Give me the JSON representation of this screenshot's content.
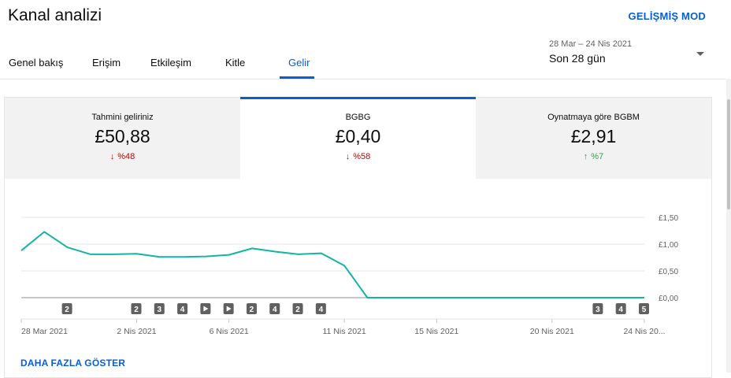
{
  "header": {
    "title": "Kanal analizi",
    "advanced_mode": "GELİŞMİŞ MOD"
  },
  "tabs": [
    {
      "label": "Genel bakış"
    },
    {
      "label": "Erişim"
    },
    {
      "label": "Etkileşim"
    },
    {
      "label": "Kitle"
    },
    {
      "label": "Gelir",
      "active": true
    }
  ],
  "date_range": {
    "range": "28 Mar – 24 Nis 2021",
    "label": "Son 28 gün"
  },
  "metrics": [
    {
      "label": "Tahmini geliriniz",
      "value": "£50,88",
      "change": "%48",
      "direction": "down"
    },
    {
      "label": "BGBG",
      "value": "£0,40",
      "change": "%58",
      "direction": "down"
    },
    {
      "label": "Oynatmaya göre BGBM",
      "value": "£2,91",
      "change": "%7",
      "direction": "up"
    }
  ],
  "colors": {
    "accent": "#065fd4",
    "line": "#12b5a3",
    "down": "#cc0000",
    "up": "#2ba640"
  },
  "chart_data": {
    "type": "line",
    "series": [
      {
        "values": [
          0.88,
          1.23,
          0.94,
          0.81,
          0.81,
          0.82,
          0.76,
          0.76,
          0.77,
          0.8,
          0.92,
          0.86,
          0.81,
          0.83,
          0.6,
          0.0,
          0.0,
          0.0,
          0.0,
          0.0,
          0.0,
          0.0,
          0.0,
          0.0,
          0.0,
          0.0,
          0.0,
          0.0
        ]
      }
    ],
    "ylim": [
      0,
      1.5
    ],
    "y_ticks": [
      "£1,50",
      "£1,00",
      "£0,50",
      "£0,00"
    ],
    "x_labels": [
      "28 Mar 2021",
      "2 Nis 2021",
      "6 Nis 2021",
      "11 Nis 2021",
      "15 Nis 2021",
      "20 Nis 2021",
      "24 Nis 20..."
    ],
    "markers": [
      "2",
      "2",
      "3",
      "4",
      "play",
      "play",
      "2",
      "4",
      "2",
      "4",
      "3",
      "4",
      "5"
    ]
  },
  "footer": {
    "show_more": "DAHA FAZLA GÖSTER"
  }
}
